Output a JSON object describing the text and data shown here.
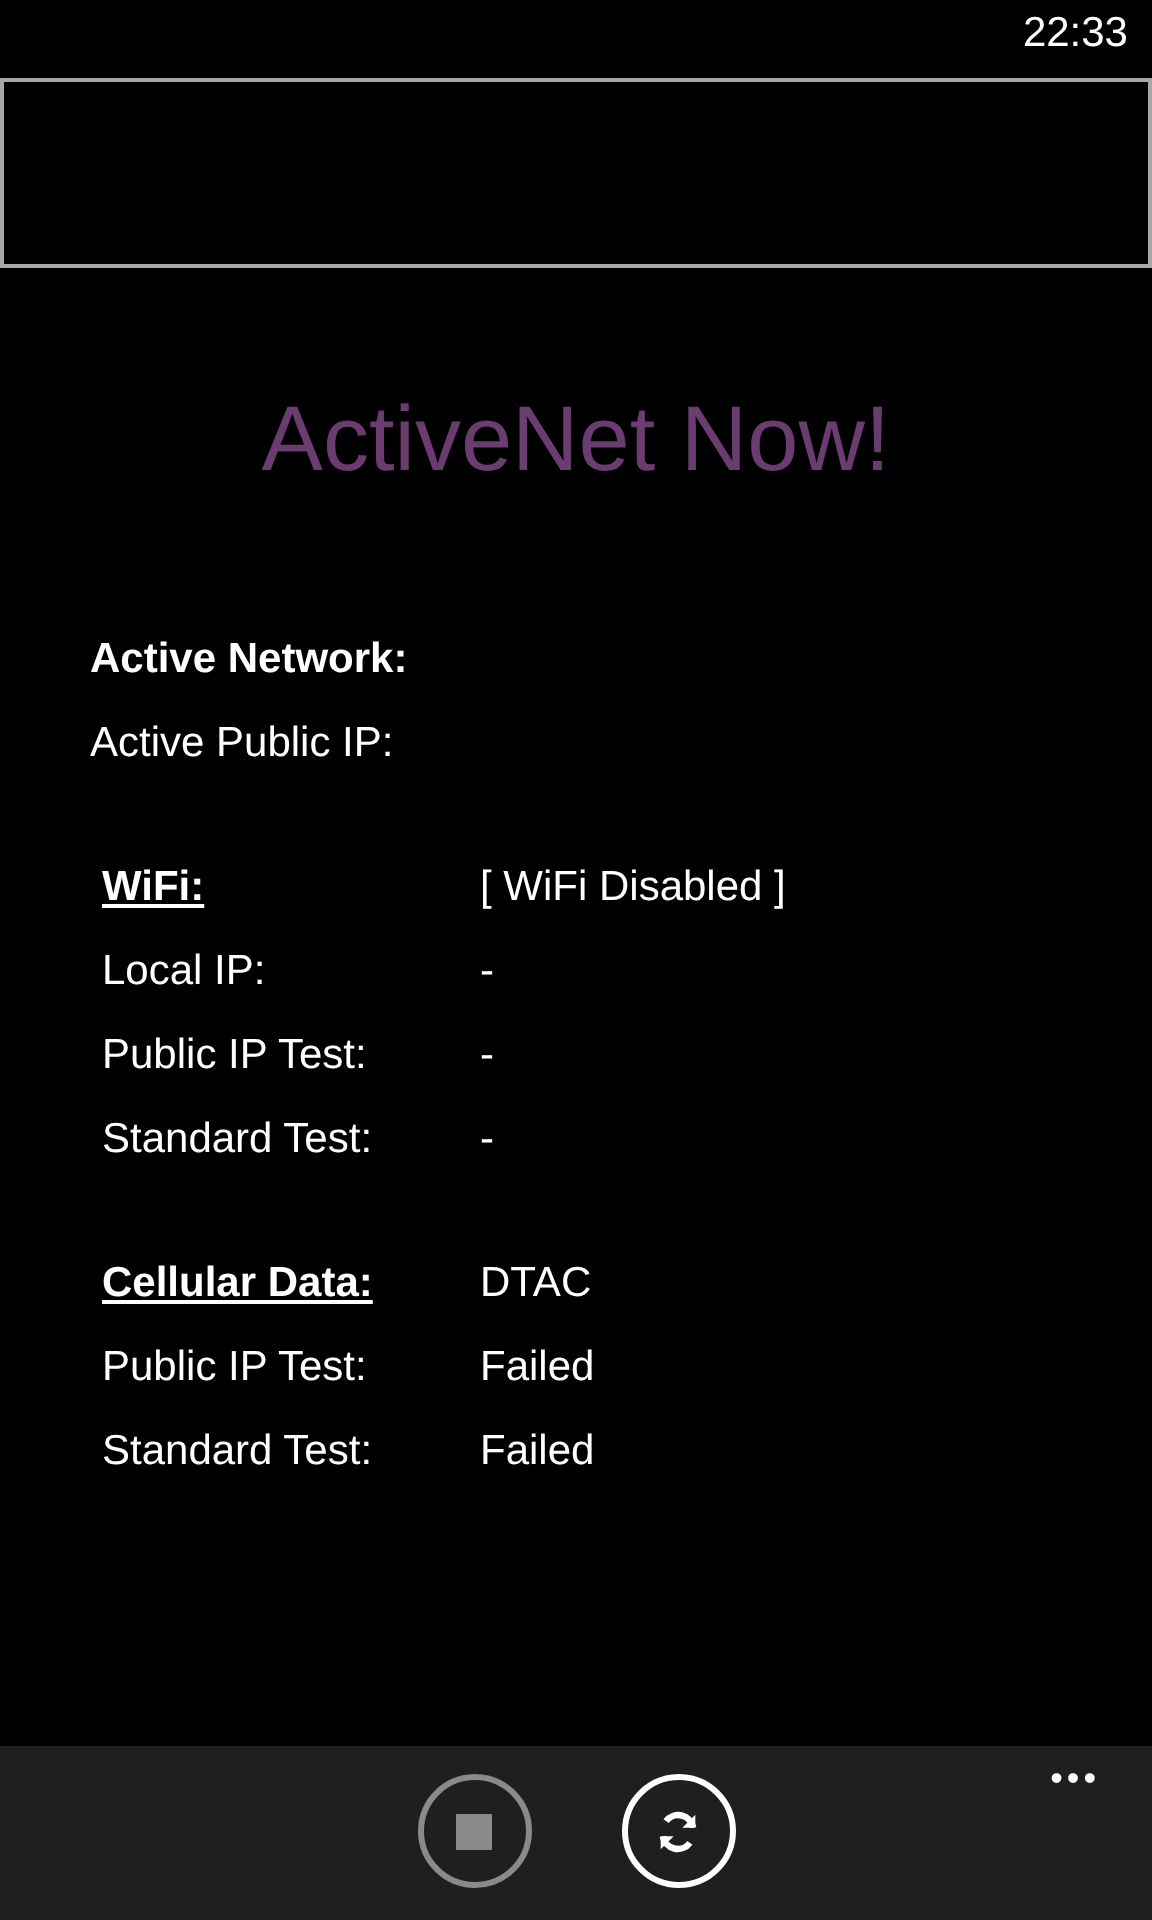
{
  "status_bar": {
    "time": "22:33"
  },
  "title": "ActiveNet Now!",
  "summary": [
    {
      "label": "Active Network:",
      "bold": true
    },
    {
      "label": "Active Public IP:",
      "bold": false
    }
  ],
  "sections": [
    {
      "heading": "WiFi:",
      "value": "[ WiFi Disabled ]",
      "rows": [
        {
          "label": "Local IP:",
          "value": "-"
        },
        {
          "label": "Public IP Test:",
          "value": "-"
        },
        {
          "label": "Standard Test:",
          "value": "-"
        }
      ]
    },
    {
      "heading": "Cellular Data:",
      "value": "DTAC",
      "rows": [
        {
          "label": "Public IP Test:",
          "value": "Failed"
        },
        {
          "label": "Standard Test:",
          "value": "Failed"
        }
      ]
    }
  ],
  "app_bar": {
    "buttons": [
      {
        "kind": "stop",
        "disabled": true
      },
      {
        "kind": "refresh",
        "disabled": false
      }
    ],
    "more": "•••"
  }
}
